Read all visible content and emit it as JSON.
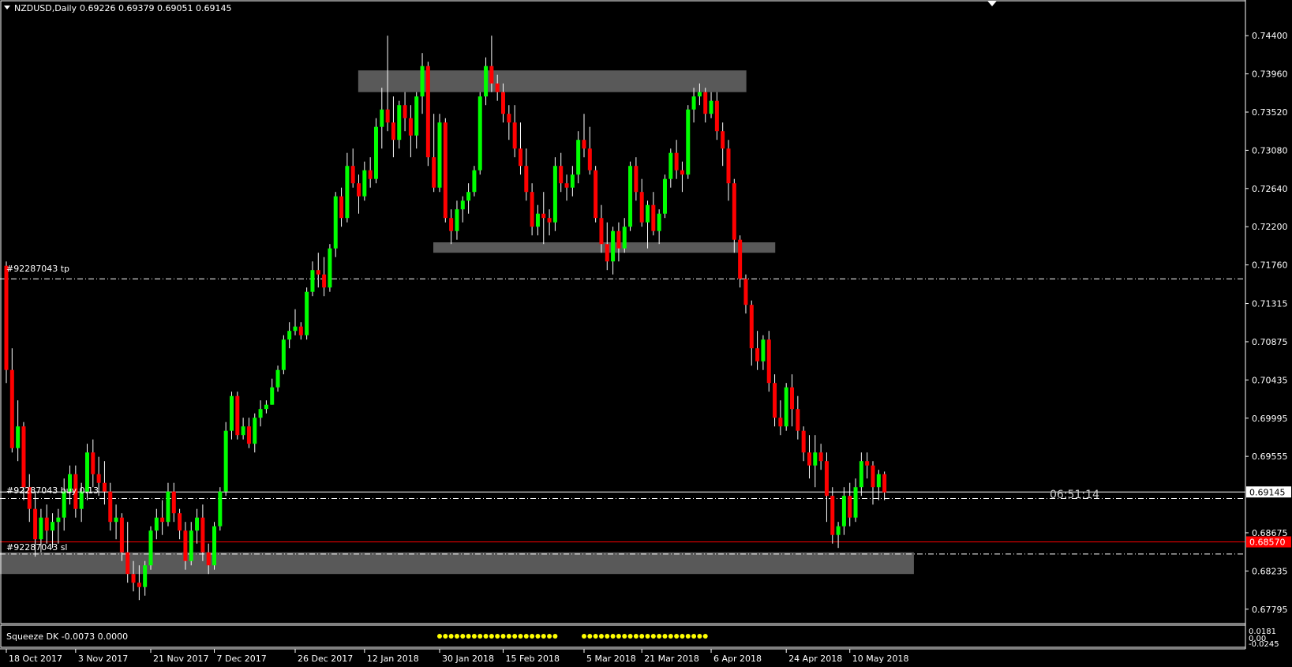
{
  "header": {
    "symbol": "NZDUSD,Daily",
    "ohlc": "0.69226 0.69379 0.69051 0.69145"
  },
  "order_lines": {
    "tp_label": "#92287043 tp",
    "buy_label": "#92287043 buy 0.13",
    "sl_label": "#92287043 sl"
  },
  "countdown": "06:51:14",
  "indicator": {
    "label": "Squeeze DK -0.0073 0.0000",
    "scale_top": "0.0181",
    "scale_mid": "0.00",
    "scale_bottom": "-0.0245"
  },
  "colors": {
    "background": "#000000",
    "bull": "#00ff00",
    "bear": "#ff0000",
    "wick": "#ffffff",
    "zone": "#595959",
    "dots": "#ffff00",
    "sl_line": "#ff0000",
    "price_line": "#ffffff",
    "axis": "#ffffff"
  },
  "chart_data": {
    "type": "candlestick",
    "symbol": "NZDUSD",
    "timeframe": "Daily",
    "y_ticks": [
      "0.74400",
      "0.73960",
      "0.73520",
      "0.73080",
      "0.72640",
      "0.72200",
      "0.71760",
      "0.71315",
      "0.70875",
      "0.70435",
      "0.69995",
      "0.69555",
      "0.68675",
      "0.68235",
      "0.67795"
    ],
    "ylim": [
      0.6772,
      0.7472
    ],
    "current_price": "0.69145",
    "sl_price": "0.68570",
    "x_ticks": [
      "18 Oct 2017",
      "3 Nov 2017",
      "21 Nov 2017",
      "7 Dec 2017",
      "26 Dec 2017",
      "12 Jan 2018",
      "30 Jan 2018",
      "15 Feb 2018",
      "5 Mar 2018",
      "21 Mar 2018",
      "6 Apr 2018",
      "24 Apr 2018",
      "10 May 2018"
    ],
    "levels": {
      "tp": 0.716,
      "buy": 0.6907,
      "current": 0.69145,
      "sl": 0.6857,
      "sl_dash": 0.6843
    },
    "zones": [
      {
        "from": "12 Jan 2018",
        "to": "13 Apr 2018",
        "low": 0.7375,
        "high": 0.74
      },
      {
        "from": "29 Jan 2018",
        "to": "20 Apr 2018",
        "low": 0.719,
        "high": 0.7202
      },
      {
        "from": "18 Oct 2017",
        "to": "24 May 2018",
        "low": 0.682,
        "high": 0.6845
      }
    ],
    "squeeze_dots": [
      {
        "from": "29 Jan 2018",
        "to": "26 Feb 2018"
      },
      {
        "from": "6 Mar 2018",
        "to": "5 Apr 2018"
      }
    ],
    "ohlc": [
      [
        0.7175,
        0.718,
        0.704,
        0.7055
      ],
      [
        0.7055,
        0.708,
        0.696,
        0.6965
      ],
      [
        0.6965,
        0.702,
        0.695,
        0.699
      ],
      [
        0.699,
        0.6995,
        0.6905,
        0.692
      ],
      [
        0.692,
        0.6935,
        0.688,
        0.6895
      ],
      [
        0.6895,
        0.6915,
        0.684,
        0.686
      ],
      [
        0.686,
        0.6895,
        0.6845,
        0.6885
      ],
      [
        0.6885,
        0.69,
        0.6855,
        0.687
      ],
      [
        0.687,
        0.689,
        0.685,
        0.688
      ],
      [
        0.688,
        0.6895,
        0.6855,
        0.6885
      ],
      [
        0.6885,
        0.693,
        0.687,
        0.6915
      ],
      [
        0.6915,
        0.6945,
        0.69,
        0.6935
      ],
      [
        0.6935,
        0.6945,
        0.6885,
        0.6895
      ],
      [
        0.6895,
        0.6925,
        0.688,
        0.6915
      ],
      [
        0.6915,
        0.697,
        0.6905,
        0.696
      ],
      [
        0.696,
        0.6975,
        0.692,
        0.6935
      ],
      [
        0.6935,
        0.6955,
        0.691,
        0.6925
      ],
      [
        0.6925,
        0.695,
        0.69,
        0.6915
      ],
      [
        0.6915,
        0.6925,
        0.687,
        0.688
      ],
      [
        0.688,
        0.69,
        0.686,
        0.6885
      ],
      [
        0.6885,
        0.689,
        0.6835,
        0.6845
      ],
      [
        0.6845,
        0.688,
        0.681,
        0.682
      ],
      [
        0.682,
        0.6835,
        0.68,
        0.681
      ],
      [
        0.681,
        0.683,
        0.679,
        0.6805
      ],
      [
        0.6805,
        0.6835,
        0.6795,
        0.683
      ],
      [
        0.683,
        0.6875,
        0.6825,
        0.687
      ],
      [
        0.687,
        0.6895,
        0.686,
        0.6885
      ],
      [
        0.6885,
        0.6905,
        0.6865,
        0.688
      ],
      [
        0.688,
        0.6925,
        0.6875,
        0.6915
      ],
      [
        0.6915,
        0.6925,
        0.688,
        0.689
      ],
      [
        0.689,
        0.6895,
        0.686,
        0.687
      ],
      [
        0.687,
        0.688,
        0.6825,
        0.6835
      ],
      [
        0.6835,
        0.688,
        0.683,
        0.687
      ],
      [
        0.687,
        0.6895,
        0.6855,
        0.6885
      ],
      [
        0.6885,
        0.69,
        0.6835,
        0.6845
      ],
      [
        0.6845,
        0.6855,
        0.682,
        0.683
      ],
      [
        0.683,
        0.688,
        0.6825,
        0.6875
      ],
      [
        0.6875,
        0.692,
        0.687,
        0.6915
      ],
      [
        0.6915,
        0.6995,
        0.691,
        0.6985
      ],
      [
        0.6985,
        0.703,
        0.6975,
        0.7025
      ],
      [
        0.7025,
        0.703,
        0.6975,
        0.698
      ],
      [
        0.698,
        0.7,
        0.6975,
        0.699
      ],
      [
        0.699,
        0.7,
        0.6965,
        0.697
      ],
      [
        0.697,
        0.7005,
        0.696,
        0.7
      ],
      [
        0.7,
        0.702,
        0.699,
        0.701
      ],
      [
        0.701,
        0.702,
        0.7005,
        0.7015
      ],
      [
        0.7015,
        0.7045,
        0.7015,
        0.7035
      ],
      [
        0.7035,
        0.706,
        0.703,
        0.7055
      ],
      [
        0.7055,
        0.7095,
        0.705,
        0.709
      ],
      [
        0.709,
        0.711,
        0.708,
        0.71
      ],
      [
        0.71,
        0.7125,
        0.7095,
        0.7105
      ],
      [
        0.7105,
        0.711,
        0.709,
        0.7095
      ],
      [
        0.7095,
        0.715,
        0.709,
        0.7145
      ],
      [
        0.7145,
        0.718,
        0.714,
        0.717
      ],
      [
        0.717,
        0.719,
        0.715,
        0.7165
      ],
      [
        0.7165,
        0.7185,
        0.714,
        0.715
      ],
      [
        0.715,
        0.72,
        0.7145,
        0.7195
      ],
      [
        0.7195,
        0.726,
        0.7185,
        0.7255
      ],
      [
        0.7255,
        0.7265,
        0.722,
        0.723
      ],
      [
        0.723,
        0.7305,
        0.7225,
        0.729
      ],
      [
        0.729,
        0.731,
        0.7265,
        0.727
      ],
      [
        0.727,
        0.728,
        0.7235,
        0.7255
      ],
      [
        0.7255,
        0.7295,
        0.725,
        0.7285
      ],
      [
        0.7285,
        0.73,
        0.7265,
        0.7275
      ],
      [
        0.7275,
        0.7345,
        0.727,
        0.7335
      ],
      [
        0.7335,
        0.738,
        0.731,
        0.7355
      ],
      [
        0.7355,
        0.744,
        0.733,
        0.734
      ],
      [
        0.734,
        0.737,
        0.73,
        0.732
      ],
      [
        0.732,
        0.7365,
        0.731,
        0.736
      ],
      [
        0.736,
        0.7375,
        0.733,
        0.7345
      ],
      [
        0.7345,
        0.736,
        0.73,
        0.7325
      ],
      [
        0.7325,
        0.7375,
        0.731,
        0.737
      ],
      [
        0.737,
        0.742,
        0.735,
        0.7405
      ],
      [
        0.7405,
        0.741,
        0.729,
        0.73
      ],
      [
        0.73,
        0.735,
        0.726,
        0.7265
      ],
      [
        0.7265,
        0.735,
        0.726,
        0.734
      ],
      [
        0.734,
        0.7345,
        0.7225,
        0.723
      ],
      [
        0.723,
        0.724,
        0.72,
        0.7215
      ],
      [
        0.7215,
        0.725,
        0.7205,
        0.724
      ],
      [
        0.724,
        0.7255,
        0.7225,
        0.725
      ],
      [
        0.725,
        0.727,
        0.7235,
        0.726
      ],
      [
        0.726,
        0.729,
        0.7255,
        0.7285
      ],
      [
        0.7285,
        0.7375,
        0.728,
        0.737
      ],
      [
        0.737,
        0.7415,
        0.736,
        0.7405
      ],
      [
        0.7405,
        0.744,
        0.7375,
        0.7385
      ],
      [
        0.7385,
        0.7395,
        0.7365,
        0.7375
      ],
      [
        0.7375,
        0.7385,
        0.734,
        0.735
      ],
      [
        0.735,
        0.736,
        0.732,
        0.734
      ],
      [
        0.734,
        0.736,
        0.73,
        0.731
      ],
      [
        0.731,
        0.734,
        0.728,
        0.729
      ],
      [
        0.729,
        0.731,
        0.725,
        0.726
      ],
      [
        0.726,
        0.727,
        0.721,
        0.722
      ],
      [
        0.722,
        0.7245,
        0.721,
        0.7235
      ],
      [
        0.7235,
        0.726,
        0.72,
        0.723
      ],
      [
        0.723,
        0.724,
        0.721,
        0.7225
      ],
      [
        0.7225,
        0.73,
        0.7215,
        0.729
      ],
      [
        0.729,
        0.7305,
        0.726,
        0.727
      ],
      [
        0.727,
        0.728,
        0.725,
        0.7265
      ],
      [
        0.7265,
        0.729,
        0.7255,
        0.728
      ],
      [
        0.728,
        0.733,
        0.727,
        0.732
      ],
      [
        0.732,
        0.735,
        0.73,
        0.731
      ],
      [
        0.731,
        0.7335,
        0.728,
        0.7285
      ],
      [
        0.7285,
        0.729,
        0.7225,
        0.723
      ],
      [
        0.723,
        0.7245,
        0.719,
        0.72
      ],
      [
        0.72,
        0.7225,
        0.717,
        0.718
      ],
      [
        0.718,
        0.722,
        0.7165,
        0.7215
      ],
      [
        0.7215,
        0.7225,
        0.718,
        0.7195
      ],
      [
        0.7195,
        0.723,
        0.719,
        0.722
      ],
      [
        0.722,
        0.7295,
        0.7215,
        0.729
      ],
      [
        0.729,
        0.73,
        0.725,
        0.726
      ],
      [
        0.726,
        0.7275,
        0.722,
        0.7225
      ],
      [
        0.7225,
        0.725,
        0.7195,
        0.7245
      ],
      [
        0.7245,
        0.726,
        0.721,
        0.7215
      ],
      [
        0.7215,
        0.724,
        0.72,
        0.7235
      ],
      [
        0.7235,
        0.728,
        0.723,
        0.7275
      ],
      [
        0.7275,
        0.731,
        0.7265,
        0.7305
      ],
      [
        0.7305,
        0.732,
        0.7275,
        0.7285
      ],
      [
        0.7285,
        0.7295,
        0.726,
        0.728
      ],
      [
        0.728,
        0.736,
        0.7275,
        0.7355
      ],
      [
        0.7355,
        0.738,
        0.734,
        0.737
      ],
      [
        0.737,
        0.7385,
        0.736,
        0.7375
      ],
      [
        0.7375,
        0.738,
        0.734,
        0.735
      ],
      [
        0.735,
        0.7375,
        0.7345,
        0.7365
      ],
      [
        0.7365,
        0.7375,
        0.732,
        0.733
      ],
      [
        0.733,
        0.734,
        0.729,
        0.731
      ],
      [
        0.731,
        0.732,
        0.725,
        0.727
      ],
      [
        0.727,
        0.7275,
        0.719,
        0.7205
      ],
      [
        0.7205,
        0.721,
        0.715,
        0.716
      ],
      [
        0.716,
        0.7165,
        0.712,
        0.713
      ],
      [
        0.713,
        0.7135,
        0.706,
        0.708
      ],
      [
        0.708,
        0.71,
        0.7055,
        0.7065
      ],
      [
        0.7065,
        0.7095,
        0.7055,
        0.709
      ],
      [
        0.709,
        0.71,
        0.703,
        0.704
      ],
      [
        0.704,
        0.705,
        0.699,
        0.7
      ],
      [
        0.7,
        0.702,
        0.698,
        0.699
      ],
      [
        0.699,
        0.704,
        0.6985,
        0.7035
      ],
      [
        0.7035,
        0.705,
        0.699,
        0.701
      ],
      [
        0.701,
        0.7025,
        0.6975,
        0.6985
      ],
      [
        0.6985,
        0.699,
        0.695,
        0.696
      ],
      [
        0.696,
        0.698,
        0.693,
        0.6945
      ],
      [
        0.6945,
        0.698,
        0.692,
        0.696
      ],
      [
        0.696,
        0.697,
        0.694,
        0.695
      ],
      [
        0.695,
        0.696,
        0.688,
        0.691
      ],
      [
        0.691,
        0.692,
        0.6855,
        0.6865
      ],
      [
        0.6865,
        0.688,
        0.685,
        0.6875
      ],
      [
        0.6875,
        0.692,
        0.6865,
        0.691
      ],
      [
        0.691,
        0.6925,
        0.6875,
        0.6885
      ],
      [
        0.6885,
        0.693,
        0.688,
        0.692
      ],
      [
        0.692,
        0.696,
        0.691,
        0.695
      ],
      [
        0.695,
        0.696,
        0.693,
        0.6945
      ],
      [
        0.6945,
        0.695,
        0.69,
        0.692
      ],
      [
        0.692,
        0.694,
        0.6905,
        0.6935
      ],
      [
        0.6935,
        0.6938,
        0.6905,
        0.6914
      ]
    ]
  }
}
